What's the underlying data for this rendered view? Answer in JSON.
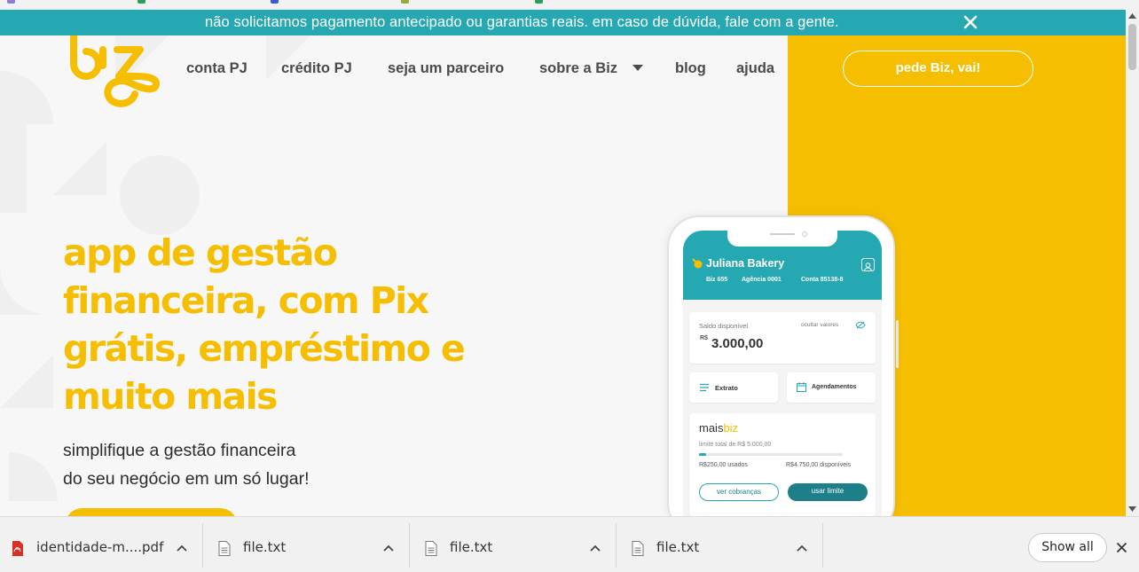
{
  "banner": {
    "text": "não solicitamos pagamento antecipado ou garantias reais. em caso de dúvida, fale com a gente."
  },
  "nav": {
    "items": [
      "conta PJ",
      "crédito PJ",
      "seja um parceiro",
      "sobre a Biz",
      "blog",
      "ajuda"
    ],
    "cta": "pede Biz, vai!"
  },
  "hero": {
    "title_lines": [
      "app de gestão",
      "financeira, com Pix",
      "grátis, empréstimo e",
      "muito mais"
    ],
    "subtitle_lines": [
      "simplifique a gestão financeira",
      "do seu negócio em um só lugar!"
    ]
  },
  "phone": {
    "business_name": "Juliana Bakery",
    "bank": "Biz 655",
    "agency": "Agência 0001",
    "account": "Conta 85138-8",
    "balance_label": "Saldo disponível",
    "hide_values": "ocultar valores",
    "currency": "R$",
    "balance": "3.000,00",
    "extrato": "Extrato",
    "agendamentos": "Agendamentos",
    "maisbiz_prefix": "mais",
    "maisbiz_suffix": "biz",
    "limit_total": "limite total de R$ 5.000,00",
    "used": "R$250,00 usados",
    "available": "R$4.750,00 disponíveis",
    "used_fraction": 0.05,
    "btn_cobrancas": "ver cobranças",
    "btn_limite": "usar limite"
  },
  "downloads": {
    "items": [
      {
        "name": "identidade-m....pdf",
        "icon": "pdf-icon"
      },
      {
        "name": "file.txt",
        "icon": "text-file-icon"
      },
      {
        "name": "file.txt",
        "icon": "text-file-icon"
      },
      {
        "name": "file.txt",
        "icon": "text-file-icon"
      }
    ],
    "show_all": "Show all"
  },
  "colors": {
    "teal": "#26a8b3",
    "yellow": "#f5be00",
    "dark_teal": "#1d7f8a"
  }
}
